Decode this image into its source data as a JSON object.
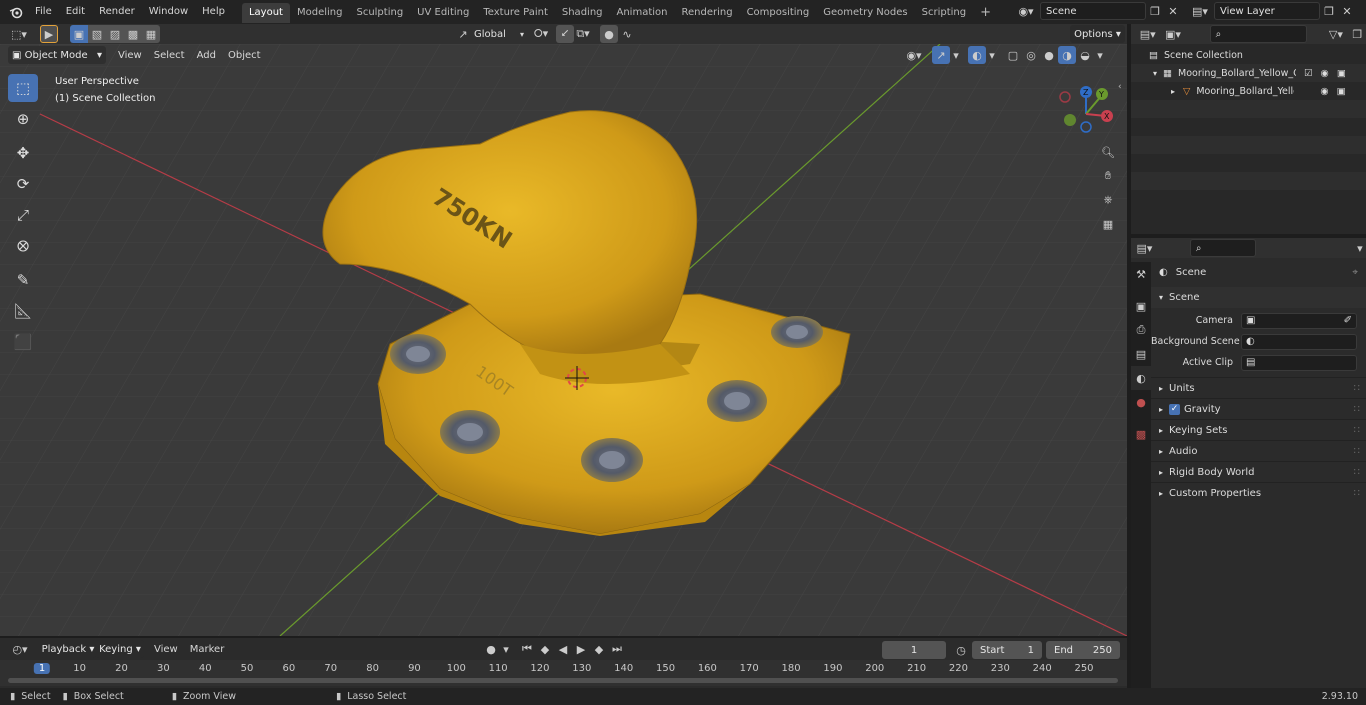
{
  "menu": [
    "File",
    "Edit",
    "Render",
    "Window",
    "Help"
  ],
  "workspaces": [
    "Layout",
    "Modeling",
    "Sculpting",
    "UV Editing",
    "Texture Paint",
    "Shading",
    "Animation",
    "Rendering",
    "Compositing",
    "Geometry Nodes",
    "Scripting"
  ],
  "scene_field": "Scene",
  "view_layer_field": "View Layer",
  "viewport": {
    "mode": "Object Mode",
    "menus": [
      "View",
      "Select",
      "Add",
      "Object"
    ],
    "transform": "Global",
    "options": "Options",
    "perspective": "User Perspective",
    "collection": "(1) Scene Collection",
    "gizmo": {
      "x": "X",
      "y": "Y",
      "z": "Z"
    },
    "model_text": "750KN",
    "model_text2": "100T"
  },
  "outliner": {
    "root": "Scene Collection",
    "items": [
      "Mooring_Bollard_Yellow_Old",
      "Mooring_Bollard_Yellow_("
    ]
  },
  "properties": {
    "title": "Scene",
    "section": "Scene",
    "camera_label": "Camera",
    "bg_scene_label": "Background Scene",
    "clip_label": "Active Clip",
    "panels": [
      "Units",
      "Gravity",
      "Keying Sets",
      "Audio",
      "Rigid Body World",
      "Custom Properties"
    ]
  },
  "timeline": {
    "menus": [
      "Playback",
      "Keying",
      "View",
      "Marker"
    ],
    "current_frame": "1",
    "start_label": "Start",
    "start": "1",
    "end_label": "End",
    "end": "250",
    "ticks": [
      "1",
      "10",
      "20",
      "30",
      "40",
      "50",
      "60",
      "70",
      "80",
      "90",
      "100",
      "110",
      "120",
      "130",
      "140",
      "150",
      "160",
      "170",
      "180",
      "190",
      "200",
      "210",
      "220",
      "230",
      "240",
      "250"
    ]
  },
  "status": {
    "select": "Select",
    "box_select": "Box Select",
    "zoom": "Zoom View",
    "lasso": "Lasso Select",
    "version": "2.93.10"
  },
  "colors": {
    "accent": "#4772b3",
    "model": "#d9a81e",
    "x_axis": "#b53c47",
    "y_axis": "#6a9a2d"
  }
}
